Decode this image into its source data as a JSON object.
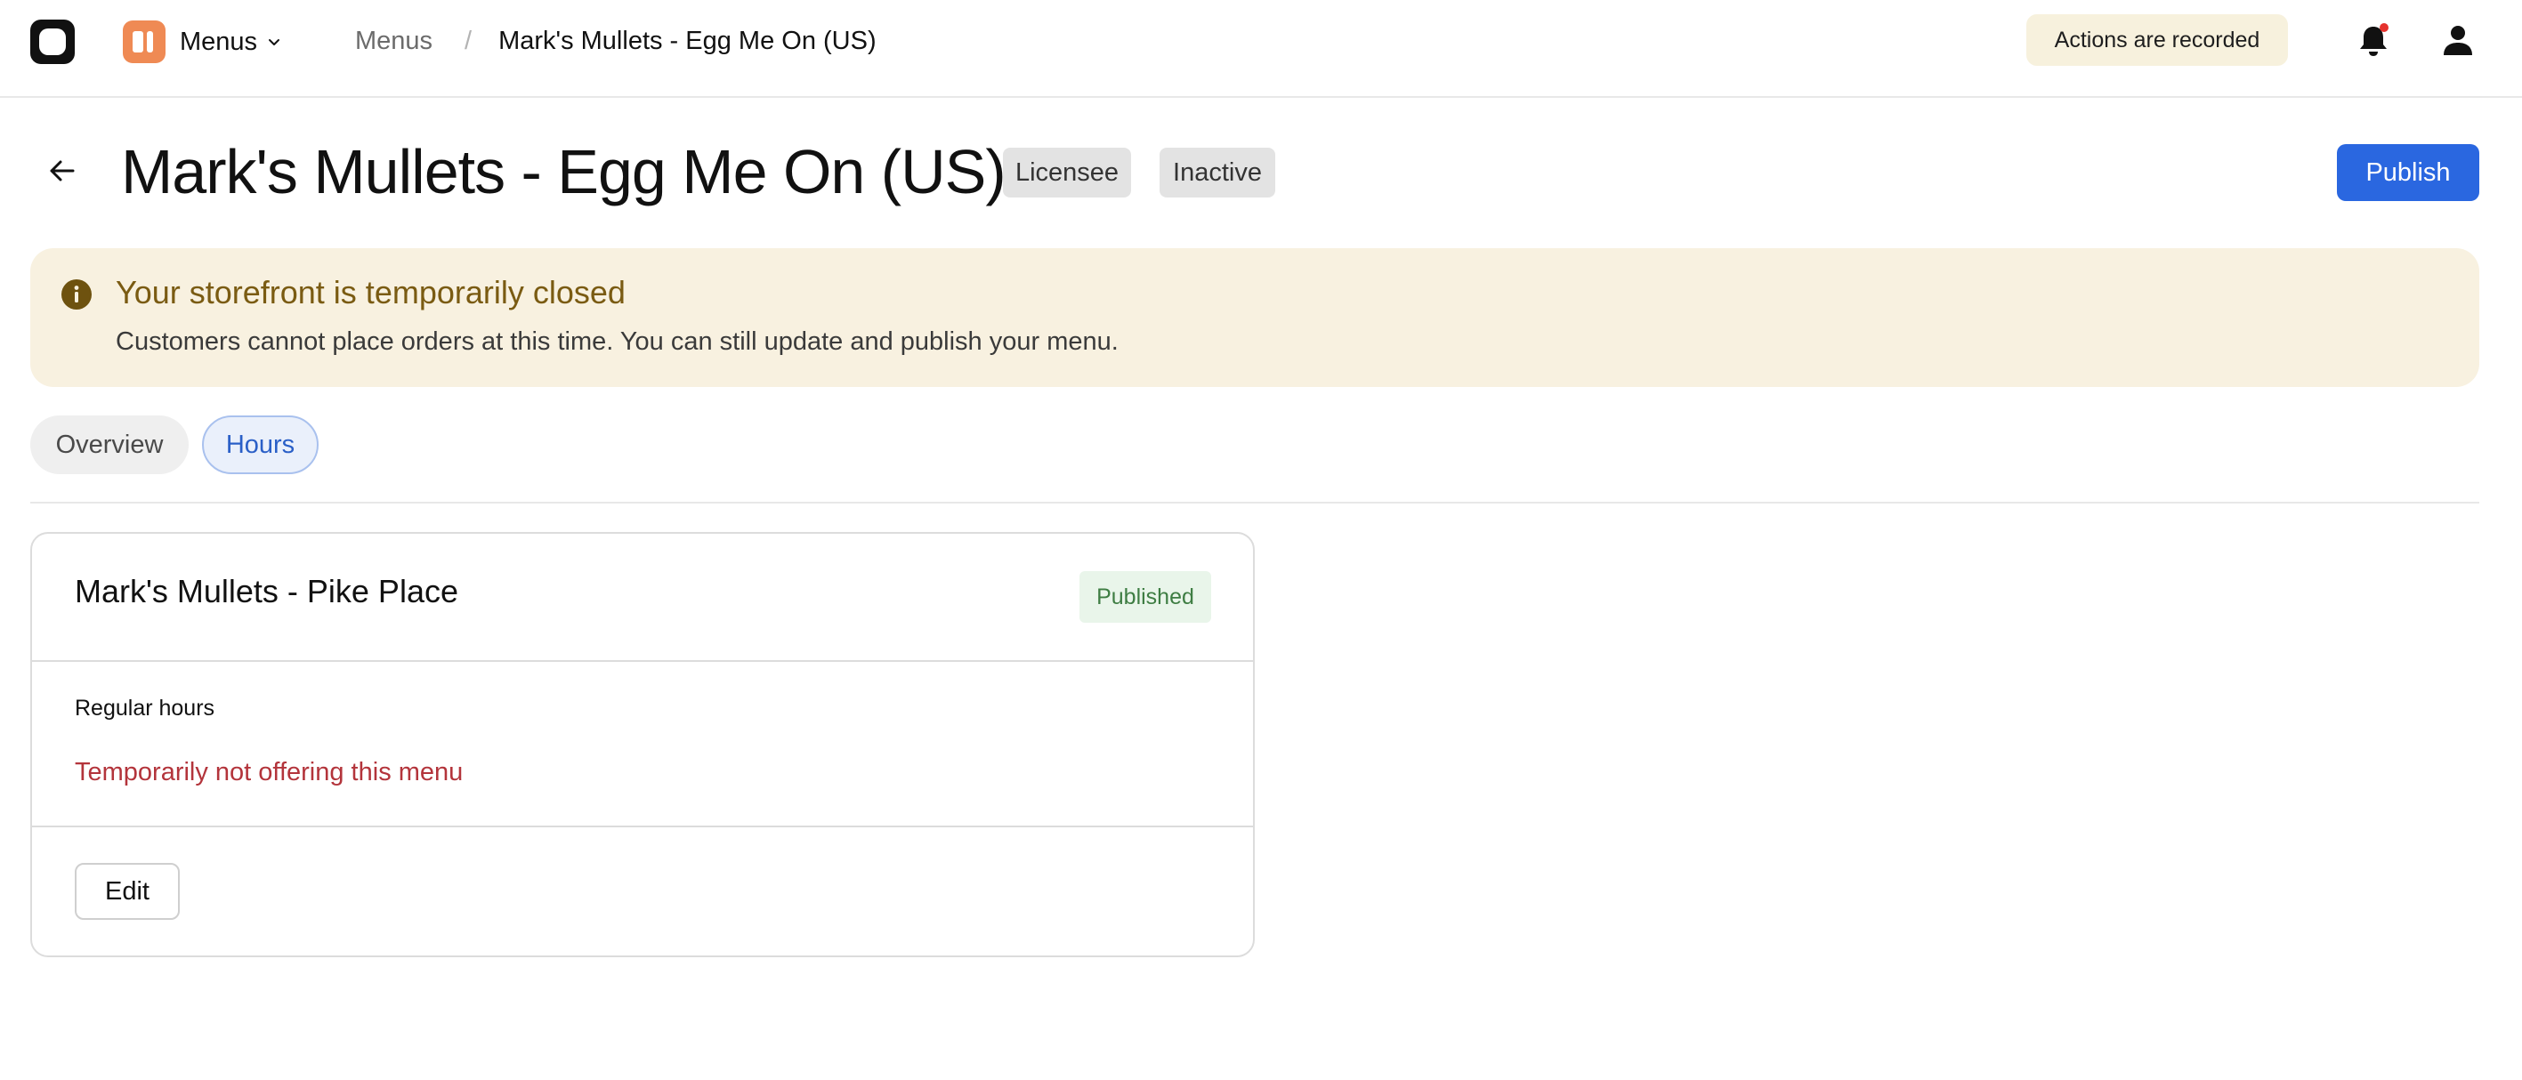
{
  "topbar": {
    "app_logo_icon": "app-logo-icon",
    "section_icon": "menus-app-icon",
    "section_label": "Menus",
    "section_icon_color": "#ef8a54",
    "breadcrumb_root": "Menus",
    "breadcrumb_sep": "/",
    "breadcrumb_current": "Mark's Mullets - Egg Me On (US)",
    "recorded_badge": "Actions are recorded",
    "notification_dot_color": "#e5322d"
  },
  "header": {
    "title": "Mark's Mullets - Egg Me On (US)",
    "tags": [
      "Licensee",
      "Inactive"
    ],
    "publish_label": "Publish",
    "accent_color": "#2a67e0"
  },
  "banner": {
    "title": "Your storefront is temporarily closed",
    "text": "Customers cannot place orders at this time. You can still update and publish your menu."
  },
  "tabs": [
    {
      "label": "Overview",
      "active": false
    },
    {
      "label": "Hours",
      "active": true
    }
  ],
  "card": {
    "title": "Mark's Mullets - Pike Place",
    "status": "Published",
    "hours_label": "Regular hours",
    "hours_value": "Temporarily not offering this menu",
    "edit_label": "Edit"
  }
}
